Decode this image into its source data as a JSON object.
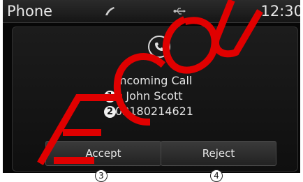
{
  "statusbar": {
    "title": "Phone",
    "clock": "12:30",
    "icons": [
      "phone-handset-icon",
      "usb-icon"
    ]
  },
  "incoming_call": {
    "icon": "phone-call-icon",
    "heading": "Incoming Call",
    "caller_name": "John Scott",
    "caller_number": "03180214621",
    "name_marker": "1",
    "number_marker": "2"
  },
  "actions": {
    "accept_label": "Accept",
    "reject_label": "Reject",
    "accept_marker": "3",
    "reject_marker": "4"
  },
  "watermark": {
    "text": "ECOU",
    "color": "#e00000"
  },
  "colors": {
    "screen_bg": "#070707",
    "text": "#e4e4e4",
    "button_border": "#4a4a4a"
  }
}
